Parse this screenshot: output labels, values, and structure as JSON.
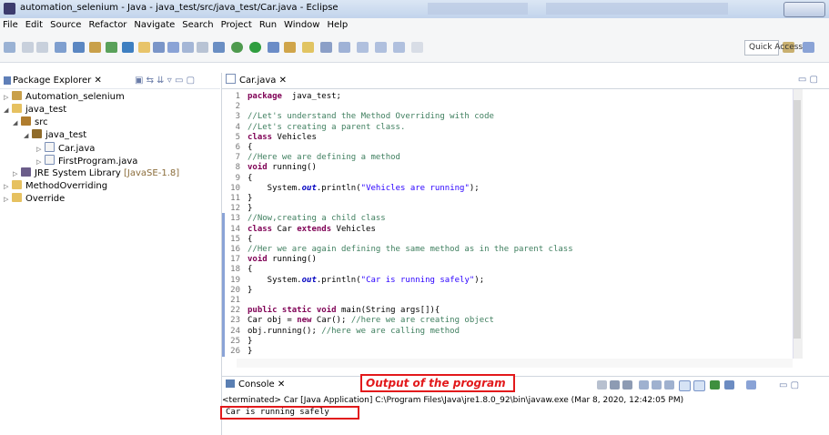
{
  "window": {
    "title": "automation_selenium - Java - java_test/src/java_test/Car.java - Eclipse"
  },
  "menu": [
    "File",
    "Edit",
    "Source",
    "Refactor",
    "Navigate",
    "Search",
    "Project",
    "Run",
    "Window",
    "Help"
  ],
  "toolbar": {
    "quick_access": "Quick Access"
  },
  "package_explorer": {
    "title": "Package Explorer",
    "items": [
      {
        "label": "Automation_selenium",
        "icon": "project-icon"
      },
      {
        "label": "java_test",
        "icon": "project-icon"
      },
      {
        "label": "src",
        "icon": "source-folder-icon"
      },
      {
        "label": "java_test",
        "icon": "package-icon"
      },
      {
        "label": "Car.java",
        "icon": "java-file-icon"
      },
      {
        "label": "FirstProgram.java",
        "icon": "java-file-icon"
      },
      {
        "label": "JRE System Library",
        "suffix": "[JavaSE-1.8]",
        "icon": "library-icon"
      },
      {
        "label": "MethodOverriding",
        "icon": "project-icon"
      },
      {
        "label": "Override",
        "icon": "project-icon"
      }
    ]
  },
  "editor": {
    "tab": "Car.java",
    "lines": [
      {
        "n": "1",
        "t": [
          [
            "kw",
            "package"
          ],
          [
            "",
            "  java_test;"
          ]
        ]
      },
      {
        "n": "2",
        "t": []
      },
      {
        "n": "3",
        "t": [
          [
            "cm",
            "//Let's understand the Method Overriding with code"
          ]
        ]
      },
      {
        "n": "4",
        "t": [
          [
            "cm",
            "//Let's creating a parent class."
          ]
        ]
      },
      {
        "n": "5",
        "t": [
          [
            "kw",
            "class"
          ],
          [
            "",
            " Vehicles"
          ]
        ]
      },
      {
        "n": "6",
        "t": [
          [
            "",
            "{"
          ]
        ]
      },
      {
        "n": "7",
        "t": [
          [
            "cm",
            "//Here we are defining a method"
          ]
        ]
      },
      {
        "n": "8",
        "t": [
          [
            "kw",
            "void"
          ],
          [
            "",
            " running()"
          ]
        ]
      },
      {
        "n": "9",
        "t": [
          [
            "",
            "{"
          ]
        ]
      },
      {
        "n": "10",
        "t": [
          [
            "",
            "    System."
          ],
          [
            "it",
            "out"
          ],
          [
            "",
            ".println("
          ],
          [
            "st",
            "\"Vehicles are running\""
          ],
          [
            "",
            ");"
          ]
        ]
      },
      {
        "n": "11",
        "t": [
          [
            "",
            "}"
          ]
        ]
      },
      {
        "n": "12",
        "t": [
          [
            "",
            "}"
          ]
        ]
      },
      {
        "n": "13",
        "t": [
          [
            "cm",
            "//Now,creating a child class"
          ]
        ]
      },
      {
        "n": "14",
        "t": [
          [
            "kw",
            "class"
          ],
          [
            "",
            " Car "
          ],
          [
            "kw",
            "extends"
          ],
          [
            "",
            " Vehicles"
          ]
        ]
      },
      {
        "n": "15",
        "t": [
          [
            "",
            "{"
          ]
        ]
      },
      {
        "n": "16",
        "t": [
          [
            "cm",
            "//Her we are again defining the same method as in the parent class"
          ]
        ]
      },
      {
        "n": "17",
        "t": [
          [
            "kw",
            "void"
          ],
          [
            "",
            " running()"
          ]
        ]
      },
      {
        "n": "18",
        "t": [
          [
            "",
            "{"
          ]
        ]
      },
      {
        "n": "19",
        "t": [
          [
            "",
            "    System."
          ],
          [
            "it",
            "out"
          ],
          [
            "",
            ".println("
          ],
          [
            "st",
            "\"Car is running safely\""
          ],
          [
            "",
            ");"
          ]
        ]
      },
      {
        "n": "20",
        "t": [
          [
            "",
            "}"
          ]
        ]
      },
      {
        "n": "21",
        "t": []
      },
      {
        "n": "22",
        "t": [
          [
            "kw",
            "public static void"
          ],
          [
            "",
            " main(String args[]){"
          ]
        ]
      },
      {
        "n": "23",
        "t": [
          [
            "",
            "Car obj = "
          ],
          [
            "kw",
            "new"
          ],
          [
            "",
            " Car(); "
          ],
          [
            "cm",
            "//here we are creating object"
          ]
        ]
      },
      {
        "n": "24",
        "t": [
          [
            "",
            "obj.running(); "
          ],
          [
            "cm",
            "//here we are calling method"
          ]
        ]
      },
      {
        "n": "25",
        "t": [
          [
            "",
            "}"
          ]
        ]
      },
      {
        "n": "26",
        "t": [
          [
            "",
            "}"
          ]
        ]
      }
    ]
  },
  "console": {
    "title": "Console",
    "annotation": "Output of the program",
    "terminated": "<terminated> Car [Java Application] C:\\Program Files\\Java\\jre1.8.0_92\\bin\\javaw.exe (Mar 8, 2020, 12:42:05 PM)",
    "output": "Car is running safely"
  }
}
